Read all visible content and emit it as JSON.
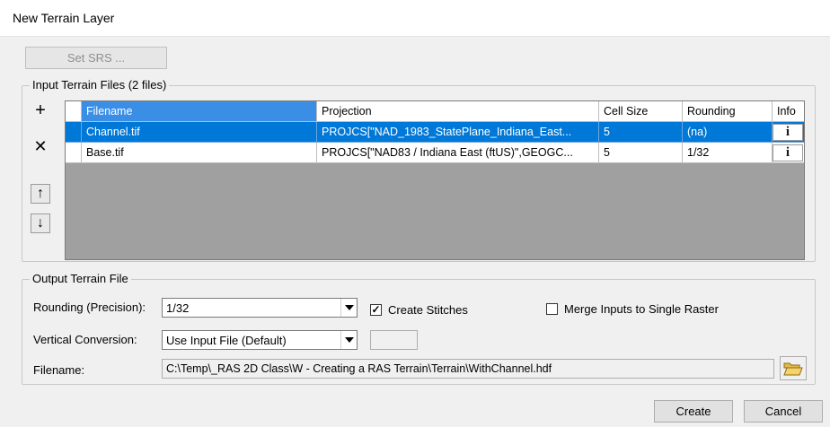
{
  "window": {
    "title": "New Terrain Layer"
  },
  "toolbar": {
    "set_srs_label": "Set SRS ..."
  },
  "input_group": {
    "legend": "Input Terrain Files (2 files)",
    "columns": [
      "Filename",
      "Projection",
      "Cell Size",
      "Rounding",
      "Info"
    ],
    "rows": [
      {
        "filename": "Channel.tif",
        "projection": "PROJCS[\"NAD_1983_StatePlane_Indiana_East...",
        "cell_size": "5",
        "rounding": "(na)",
        "info": "i",
        "selected": true
      },
      {
        "filename": "Base.tif",
        "projection": "PROJCS[\"NAD83 / Indiana East (ftUS)\",GEOGC...",
        "cell_size": "5",
        "rounding": "1/32",
        "info": "i",
        "selected": false
      }
    ],
    "side_buttons": {
      "add": "+",
      "remove": "✕",
      "up": "↑",
      "down": "↓"
    }
  },
  "output_group": {
    "legend": "Output Terrain File",
    "rounding_label": "Rounding (Precision):",
    "rounding_value": "1/32",
    "create_stitches_label": "Create Stitches",
    "create_stitches_checked": true,
    "merge_label": "Merge Inputs to Single Raster",
    "merge_checked": false,
    "vertical_label": "Vertical Conversion:",
    "vertical_value": "Use Input File (Default)",
    "filename_label": "Filename:",
    "filename_value": "C:\\Temp\\_RAS 2D Class\\W - Creating a RAS Terrain\\Terrain\\WithChannel.hdf"
  },
  "footer": {
    "create_label": "Create",
    "cancel_label": "Cancel"
  },
  "colors": {
    "selection": "#0078d7",
    "grid_background": "#a0a0a0",
    "dialog_background": "#f0f0f0"
  }
}
